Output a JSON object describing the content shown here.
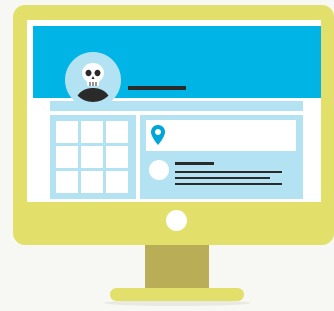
{
  "colors": {
    "monitor_frame": "#e2e06a",
    "monitor_stand": "#b9ae57",
    "banner": "#00b4e6",
    "panel": "#b3e3f3",
    "ink": "#2a2a2a"
  },
  "icons": {
    "avatar": "skull-icon",
    "location": "location-pin-icon"
  }
}
